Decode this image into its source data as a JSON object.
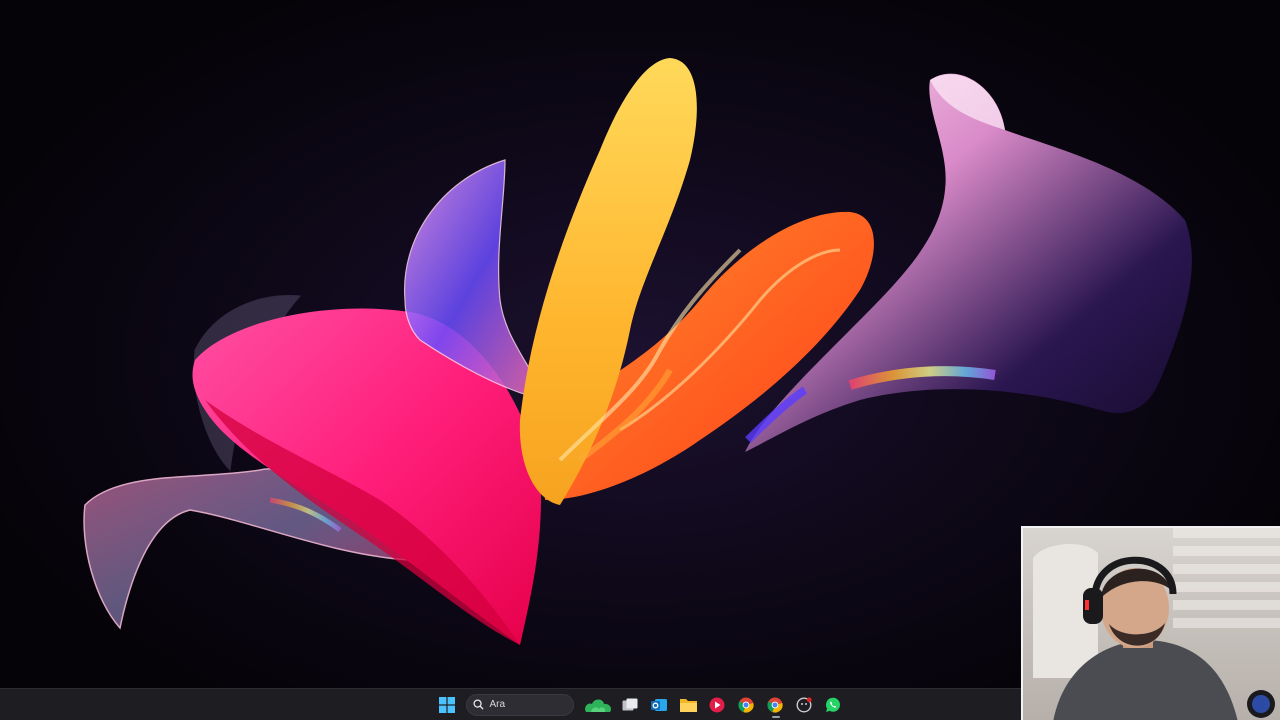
{
  "wallpaper": {
    "background": "#0e0818",
    "accent_colors": [
      "#ff1e7a",
      "#ffc83a",
      "#ff6a20",
      "#7a3cff",
      "#f7c8e8"
    ]
  },
  "webcam_overlay": {
    "shown": true
  },
  "taskbar": {
    "background": "#1d1d22",
    "search": {
      "label": "Ara"
    },
    "items": [
      {
        "icon": "windows-start-icon",
        "active": false
      },
      {
        "icon": "search-icon",
        "active": false
      },
      {
        "icon": "weather-widget-icon",
        "active": false
      },
      {
        "icon": "task-view-icon",
        "active": false
      },
      {
        "icon": "outlook-icon",
        "active": false
      },
      {
        "icon": "file-explorer-icon",
        "active": false
      },
      {
        "icon": "media-player-icon",
        "active": false
      },
      {
        "icon": "chrome-icon",
        "active": false
      },
      {
        "icon": "chrome-icon",
        "active": true
      },
      {
        "icon": "github-desktop-icon",
        "active": false
      },
      {
        "icon": "whatsapp-icon",
        "active": false
      }
    ]
  }
}
